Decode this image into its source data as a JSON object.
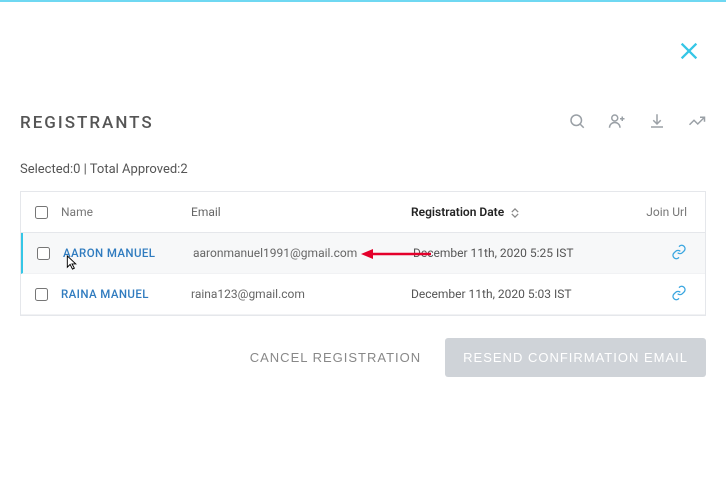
{
  "title": "REGISTRANTS",
  "status": {
    "selected_label": "Selected:",
    "selected_count": "0",
    "divider": " | ",
    "approved_label": "Total Approved:",
    "approved_count": "2"
  },
  "columns": {
    "name": "Name",
    "email": "Email",
    "date": "Registration Date",
    "join": "Join Url"
  },
  "rows": [
    {
      "name": "AARON MANUEL",
      "email": "aaronmanuel1991@gmail.com",
      "date": "December 11th, 2020 5:25 IST"
    },
    {
      "name": "RAINA MANUEL",
      "email": "raina123@gmail.com",
      "date": "December 11th, 2020 5:03 IST"
    }
  ],
  "buttons": {
    "cancel": "CANCEL REGISTRATION",
    "resend": "RESEND CONFIRMATION EMAIL"
  }
}
